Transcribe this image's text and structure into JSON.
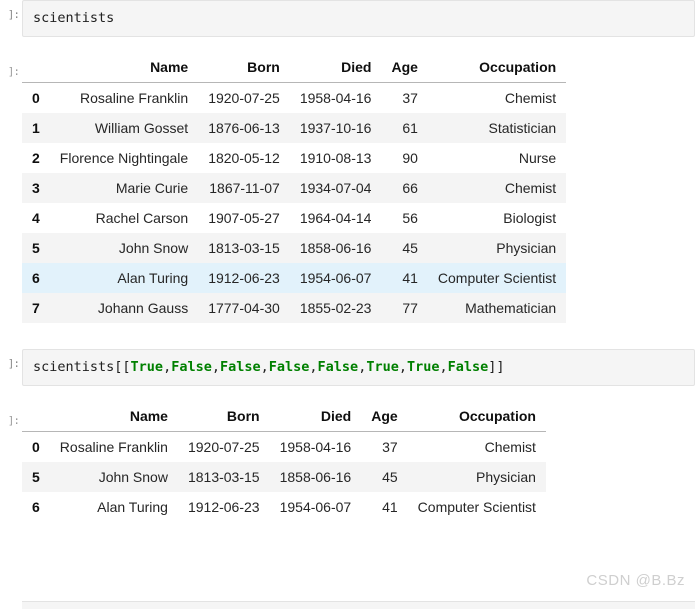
{
  "notebook": {
    "prompt_in": "]:",
    "prompt_out": "]:",
    "watermark": "CSDN @B.Bz"
  },
  "cell1": {
    "code": "scientists"
  },
  "cell1_output": {
    "index_header": "",
    "columns": [
      "Name",
      "Born",
      "Died",
      "Age",
      "Occupation"
    ],
    "rows": [
      {
        "index": "0",
        "Name": "Rosaline Franklin",
        "Born": "1920-07-25",
        "Died": "1958-04-16",
        "Age": "37",
        "Occupation": "Chemist"
      },
      {
        "index": "1",
        "Name": "William Gosset",
        "Born": "1876-06-13",
        "Died": "1937-10-16",
        "Age": "61",
        "Occupation": "Statistician"
      },
      {
        "index": "2",
        "Name": "Florence Nightingale",
        "Born": "1820-05-12",
        "Died": "1910-08-13",
        "Age": "90",
        "Occupation": "Nurse"
      },
      {
        "index": "3",
        "Name": "Marie Curie",
        "Born": "1867-11-07",
        "Died": "1934-07-04",
        "Age": "66",
        "Occupation": "Chemist"
      },
      {
        "index": "4",
        "Name": "Rachel Carson",
        "Born": "1907-05-27",
        "Died": "1964-04-14",
        "Age": "56",
        "Occupation": "Biologist"
      },
      {
        "index": "5",
        "Name": "John Snow",
        "Born": "1813-03-15",
        "Died": "1858-06-16",
        "Age": "45",
        "Occupation": "Physician"
      },
      {
        "index": "6",
        "Name": "Alan Turing",
        "Born": "1912-06-23",
        "Died": "1954-06-07",
        "Age": "41",
        "Occupation": "Computer Scientist"
      },
      {
        "index": "7",
        "Name": "Johann Gauss",
        "Born": "1777-04-30",
        "Died": "1855-02-23",
        "Age": "77",
        "Occupation": "Mathematician"
      }
    ],
    "highlighted_index": "6"
  },
  "cell2": {
    "code_parts": [
      {
        "text": "scientists[[",
        "kind": "plain"
      },
      {
        "text": "True",
        "kind": "keyword"
      },
      {
        "text": ",",
        "kind": "plain"
      },
      {
        "text": "False",
        "kind": "keyword"
      },
      {
        "text": ",",
        "kind": "plain"
      },
      {
        "text": "False",
        "kind": "keyword"
      },
      {
        "text": ",",
        "kind": "plain"
      },
      {
        "text": "False",
        "kind": "keyword"
      },
      {
        "text": ",",
        "kind": "plain"
      },
      {
        "text": "False",
        "kind": "keyword"
      },
      {
        "text": ",",
        "kind": "plain"
      },
      {
        "text": "True",
        "kind": "keyword"
      },
      {
        "text": ",",
        "kind": "plain"
      },
      {
        "text": "True",
        "kind": "keyword"
      },
      {
        "text": ",",
        "kind": "plain"
      },
      {
        "text": "False",
        "kind": "keyword"
      },
      {
        "text": "]]",
        "kind": "plain"
      }
    ]
  },
  "cell2_output": {
    "index_header": "",
    "columns": [
      "Name",
      "Born",
      "Died",
      "Age",
      "Occupation"
    ],
    "rows": [
      {
        "index": "0",
        "Name": "Rosaline Franklin",
        "Born": "1920-07-25",
        "Died": "1958-04-16",
        "Age": "37",
        "Occupation": "Chemist"
      },
      {
        "index": "5",
        "Name": "John Snow",
        "Born": "1813-03-15",
        "Died": "1858-06-16",
        "Age": "45",
        "Occupation": "Physician"
      },
      {
        "index": "6",
        "Name": "Alan Turing",
        "Born": "1912-06-23",
        "Died": "1954-06-07",
        "Age": "41",
        "Occupation": "Computer Scientist"
      }
    ]
  },
  "colors": {
    "keyword": "#008000",
    "cell_background": "#f5f5f5",
    "row_stripe": "#f4f4f4",
    "row_highlight": "#e2f2fb",
    "watermark": "#cfcfcf"
  }
}
